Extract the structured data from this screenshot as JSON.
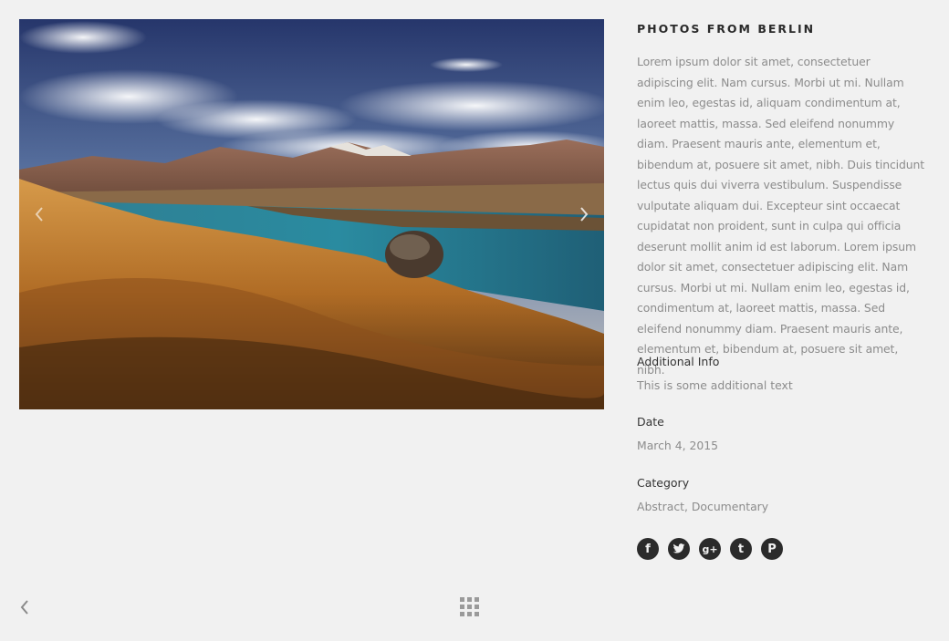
{
  "project": {
    "title": "PHOTOS FROM BERLIN",
    "description": "Lorem ipsum dolor sit amet, consectetuer adipiscing elit. Nam cursus. Morbi ut mi. Nullam enim leo, egestas id, aliquam condimentum at, laoreet mattis, massa. Sed eleifend nonummy diam. Praesent mauris ante, elementum et, bibendum at, posuere sit amet, nibh. Duis tincidunt lectus quis dui viverra vestibulum. Suspendisse vulputate aliquam dui. Excepteur sint occaecat cupidatat non proident, sunt in culpa qui officia deserunt mollit anim id est laborum. Lorem ipsum dolor sit amet, consectetuer adipiscing elit. Nam cursus. Morbi ut mi. Nullam enim leo, egestas id, condimentum at, laoreet mattis, massa. Sed eleifend nonummy diam. Praesent mauris ante, elementum et, bibendum at, posuere sit amet, nibh."
  },
  "meta": {
    "additional_info": {
      "label": "Additional Info",
      "value": "This is some additional text"
    },
    "date": {
      "label": "Date",
      "value": "March 4, 2015"
    },
    "category": {
      "label": "Category",
      "value": "Abstract, Documentary"
    }
  },
  "social": [
    {
      "icon": "facebook-icon",
      "glyph": "f"
    },
    {
      "icon": "twitter-icon",
      "glyph": "t"
    },
    {
      "icon": "google-plus-icon",
      "glyph": "g+"
    },
    {
      "icon": "tumblr-icon",
      "glyph": "t"
    },
    {
      "icon": "pinterest-icon",
      "glyph": "P"
    }
  ],
  "slider": {
    "prev_icon": "chevron-left-icon",
    "next_icon": "chevron-right-icon"
  },
  "nav": {
    "back_icon": "chevron-left-icon",
    "grid_icon": "grid-icon"
  },
  "colors": {
    "background": "#f1f1f1",
    "heading": "#2a2a2a",
    "body_text": "#8c8c8c",
    "icon_circle": "#2b2b2b",
    "nav_icon": "#9a9a9a"
  }
}
